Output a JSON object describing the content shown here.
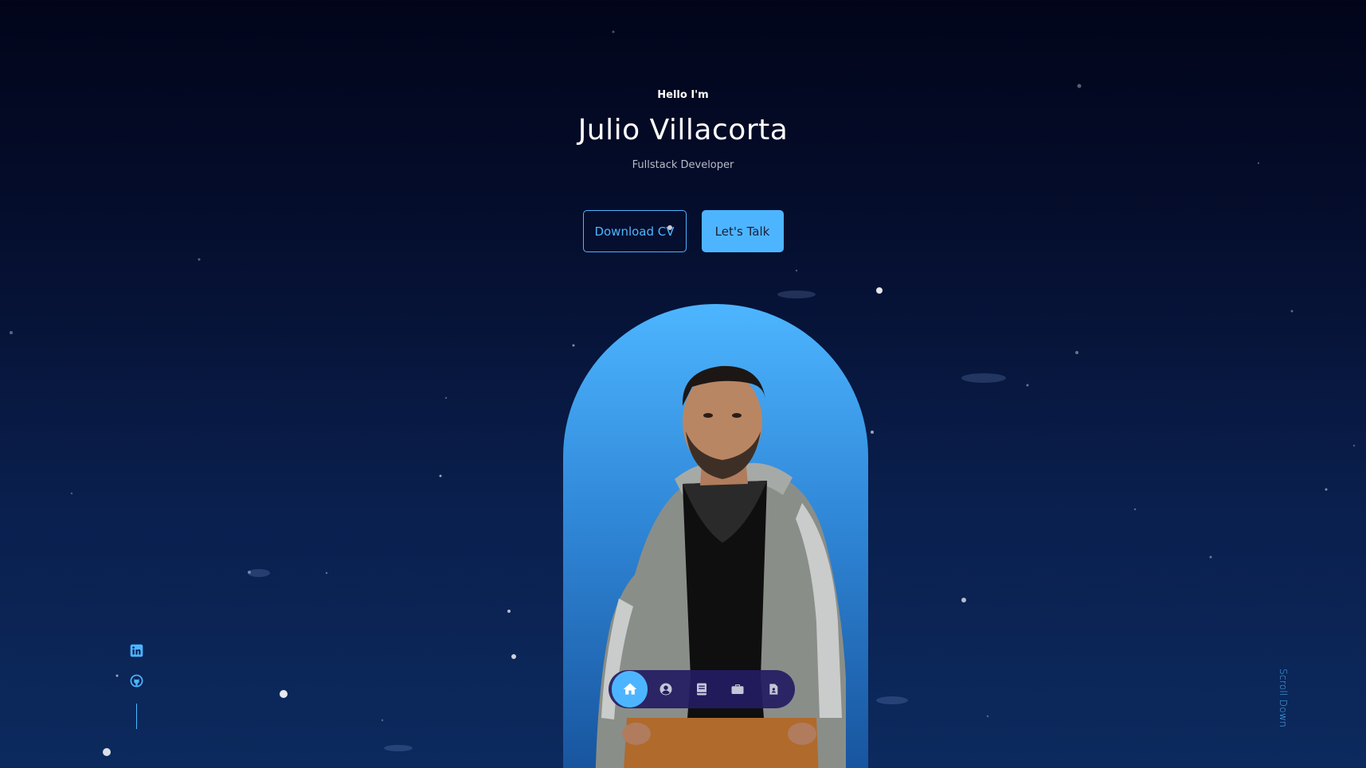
{
  "hero": {
    "greeting": "Hello I'm",
    "name": "Julio Villacorta",
    "role": "Fullstack Developer"
  },
  "cta": {
    "download_label": "Download CV",
    "talk_label": "Let's Talk"
  },
  "socials": [
    {
      "icon": "linkedin-icon"
    },
    {
      "icon": "github-icon"
    }
  ],
  "scroll_label": "Scroll Down",
  "nav": {
    "items": [
      {
        "icon": "home-icon",
        "active": true
      },
      {
        "icon": "user-icon",
        "active": false
      },
      {
        "icon": "book-icon",
        "active": false
      },
      {
        "icon": "briefcase-icon",
        "active": false
      },
      {
        "icon": "contact-icon",
        "active": false
      }
    ]
  },
  "colors": {
    "accent": "#4db5ff",
    "background_top": "#02051a",
    "background_bottom": "#0c2a5e",
    "nav_bg": "#231c62",
    "button_text_dark": "#1f1f38"
  }
}
